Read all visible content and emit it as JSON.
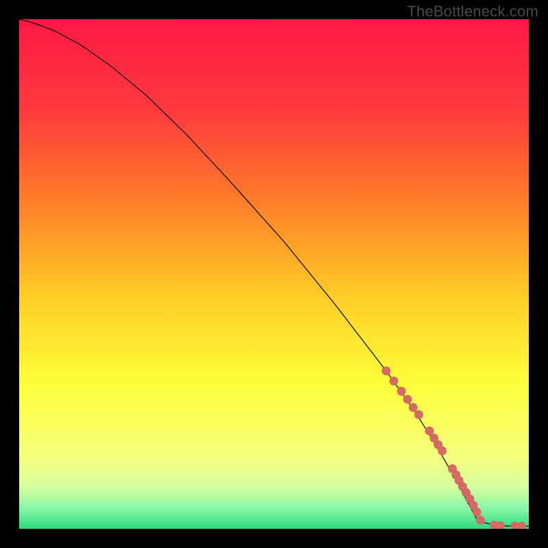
{
  "watermark": "TheBottleneck.com",
  "chart_data": {
    "type": "line",
    "title": "",
    "xlabel": "",
    "ylabel": "",
    "xlim": [
      0,
      100
    ],
    "ylim": [
      0,
      100
    ],
    "grid": false,
    "background_gradient": {
      "stops": [
        {
          "offset": 0.0,
          "color": "#ff1846"
        },
        {
          "offset": 0.18,
          "color": "#ff3a3d"
        },
        {
          "offset": 0.35,
          "color": "#ff7a2a"
        },
        {
          "offset": 0.55,
          "color": "#ffcf26"
        },
        {
          "offset": 0.72,
          "color": "#fdff3b"
        },
        {
          "offset": 0.86,
          "color": "#f6ff7d"
        },
        {
          "offset": 0.92,
          "color": "#d4ffa0"
        },
        {
          "offset": 0.96,
          "color": "#88f7a8"
        },
        {
          "offset": 1.0,
          "color": "#2fd97e"
        }
      ]
    },
    "series": [
      {
        "name": "curve",
        "color": "#000000",
        "stroke_width": 1.2,
        "x": [
          0,
          3,
          7,
          12,
          18,
          25,
          33,
          42,
          52,
          62,
          72,
          78,
          82,
          85.5,
          88,
          90,
          94,
          100
        ],
        "y": [
          100,
          99.2,
          97.7,
          95.0,
          90.8,
          85.0,
          77.2,
          67.5,
          56.3,
          44.0,
          31.0,
          22.5,
          16.0,
          10.0,
          5.2,
          1.5,
          0.6,
          0.5
        ]
      }
    ],
    "markers": {
      "name": "highlight-points",
      "color": "#d46a63",
      "radius": 6.5,
      "x": [
        72,
        73.5,
        75,
        76.2,
        77.3,
        78.4,
        80.5,
        81.4,
        82.2,
        83,
        85,
        85.7,
        86.3,
        87,
        87.7,
        88.4,
        89.1,
        89.8,
        90.5,
        93.2,
        94.4,
        97.3,
        98.6
      ],
      "y": [
        31.0,
        29.0,
        27.0,
        25.4,
        23.8,
        22.4,
        19.2,
        17.8,
        16.5,
        15.3,
        11.8,
        10.6,
        9.5,
        8.3,
        7.1,
        5.9,
        4.6,
        3.3,
        1.7,
        0.7,
        0.6,
        0.55,
        0.5
      ]
    }
  }
}
